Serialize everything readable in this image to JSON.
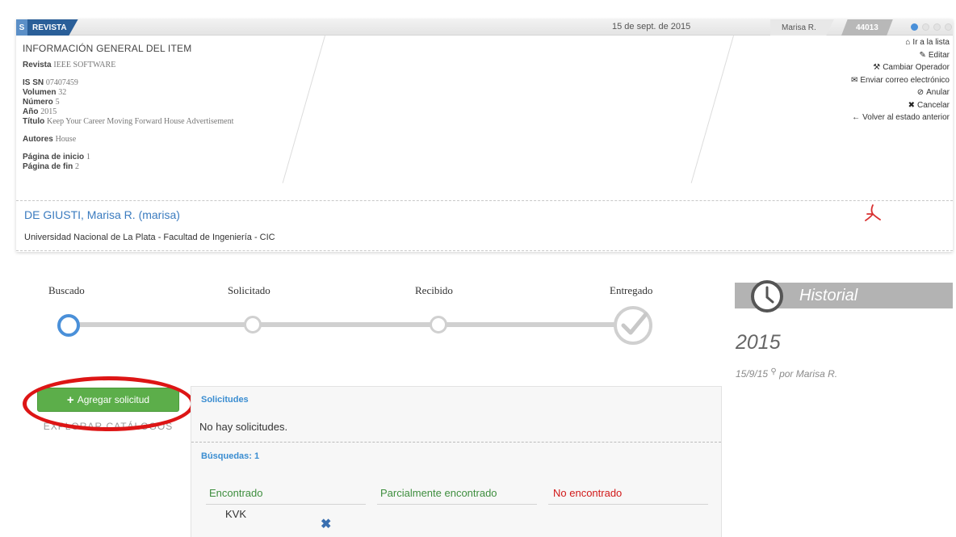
{
  "header": {
    "type_letter": "S",
    "type_label": "REVISTA",
    "date": "15 de sept. de 2015",
    "user": "Marisa R.",
    "id": "44013"
  },
  "info": {
    "heading": "INFORMACIÓN GENERAL DEL ITEM",
    "fields": {
      "revista_label": "Revista",
      "revista_value": "IEEE SOFTWARE",
      "issn_label": "IS SN",
      "issn_value": "07407459",
      "volumen_label": "Volumen",
      "volumen_value": "32",
      "numero_label": "Número",
      "numero_value": "5",
      "anio_label": "Año",
      "anio_value": "2015",
      "titulo_label": "Título",
      "titulo_value": "Keep Your Career Moving Forward House Advertisement",
      "autores_label": "Autores",
      "autores_value": "House",
      "pagina_inicio_label": "Página de inicio",
      "pagina_inicio_value": "1",
      "pagina_fin_label": "Página de fin",
      "pagina_fin_value": "2"
    }
  },
  "actions": {
    "ir_lista": "Ir a la lista",
    "editar": "Editar",
    "cambiar_operador": "Cambiar Operador",
    "enviar_correo": "Enviar correo electrónico",
    "anular": "Anular",
    "cancelar": "Cancelar",
    "volver": "Volver al estado anterior"
  },
  "person": {
    "name": "DE GIUSTI, Marisa R. (marisa)",
    "institution": "Universidad Nacional de La Plata - Facultad de Ingeniería - CIC"
  },
  "steps": [
    "Buscado",
    "Solicitado",
    "Recibido",
    "Entregado"
  ],
  "historial": {
    "title": "Historial",
    "year": "2015",
    "entry_date": "15/9/15",
    "entry_by": "por Marisa R."
  },
  "buttons": {
    "add": "Agregar solicitud",
    "explore": "EXPLORAR CATÁLOGOS"
  },
  "panel": {
    "solicitudes_title": "Solicitudes",
    "empty_text": "No hay solicitudes.",
    "busquedas_title": "Búsquedas: 1",
    "columns": {
      "found": "Encontrado",
      "partial": "Parcialmente encontrado",
      "not_found": "No encontrado"
    },
    "found_items": [
      "KVK"
    ]
  },
  "colors": {
    "accent_blue": "#4a90d9",
    "button_green": "#5cae4a",
    "highlight_red": "#dd1515"
  }
}
